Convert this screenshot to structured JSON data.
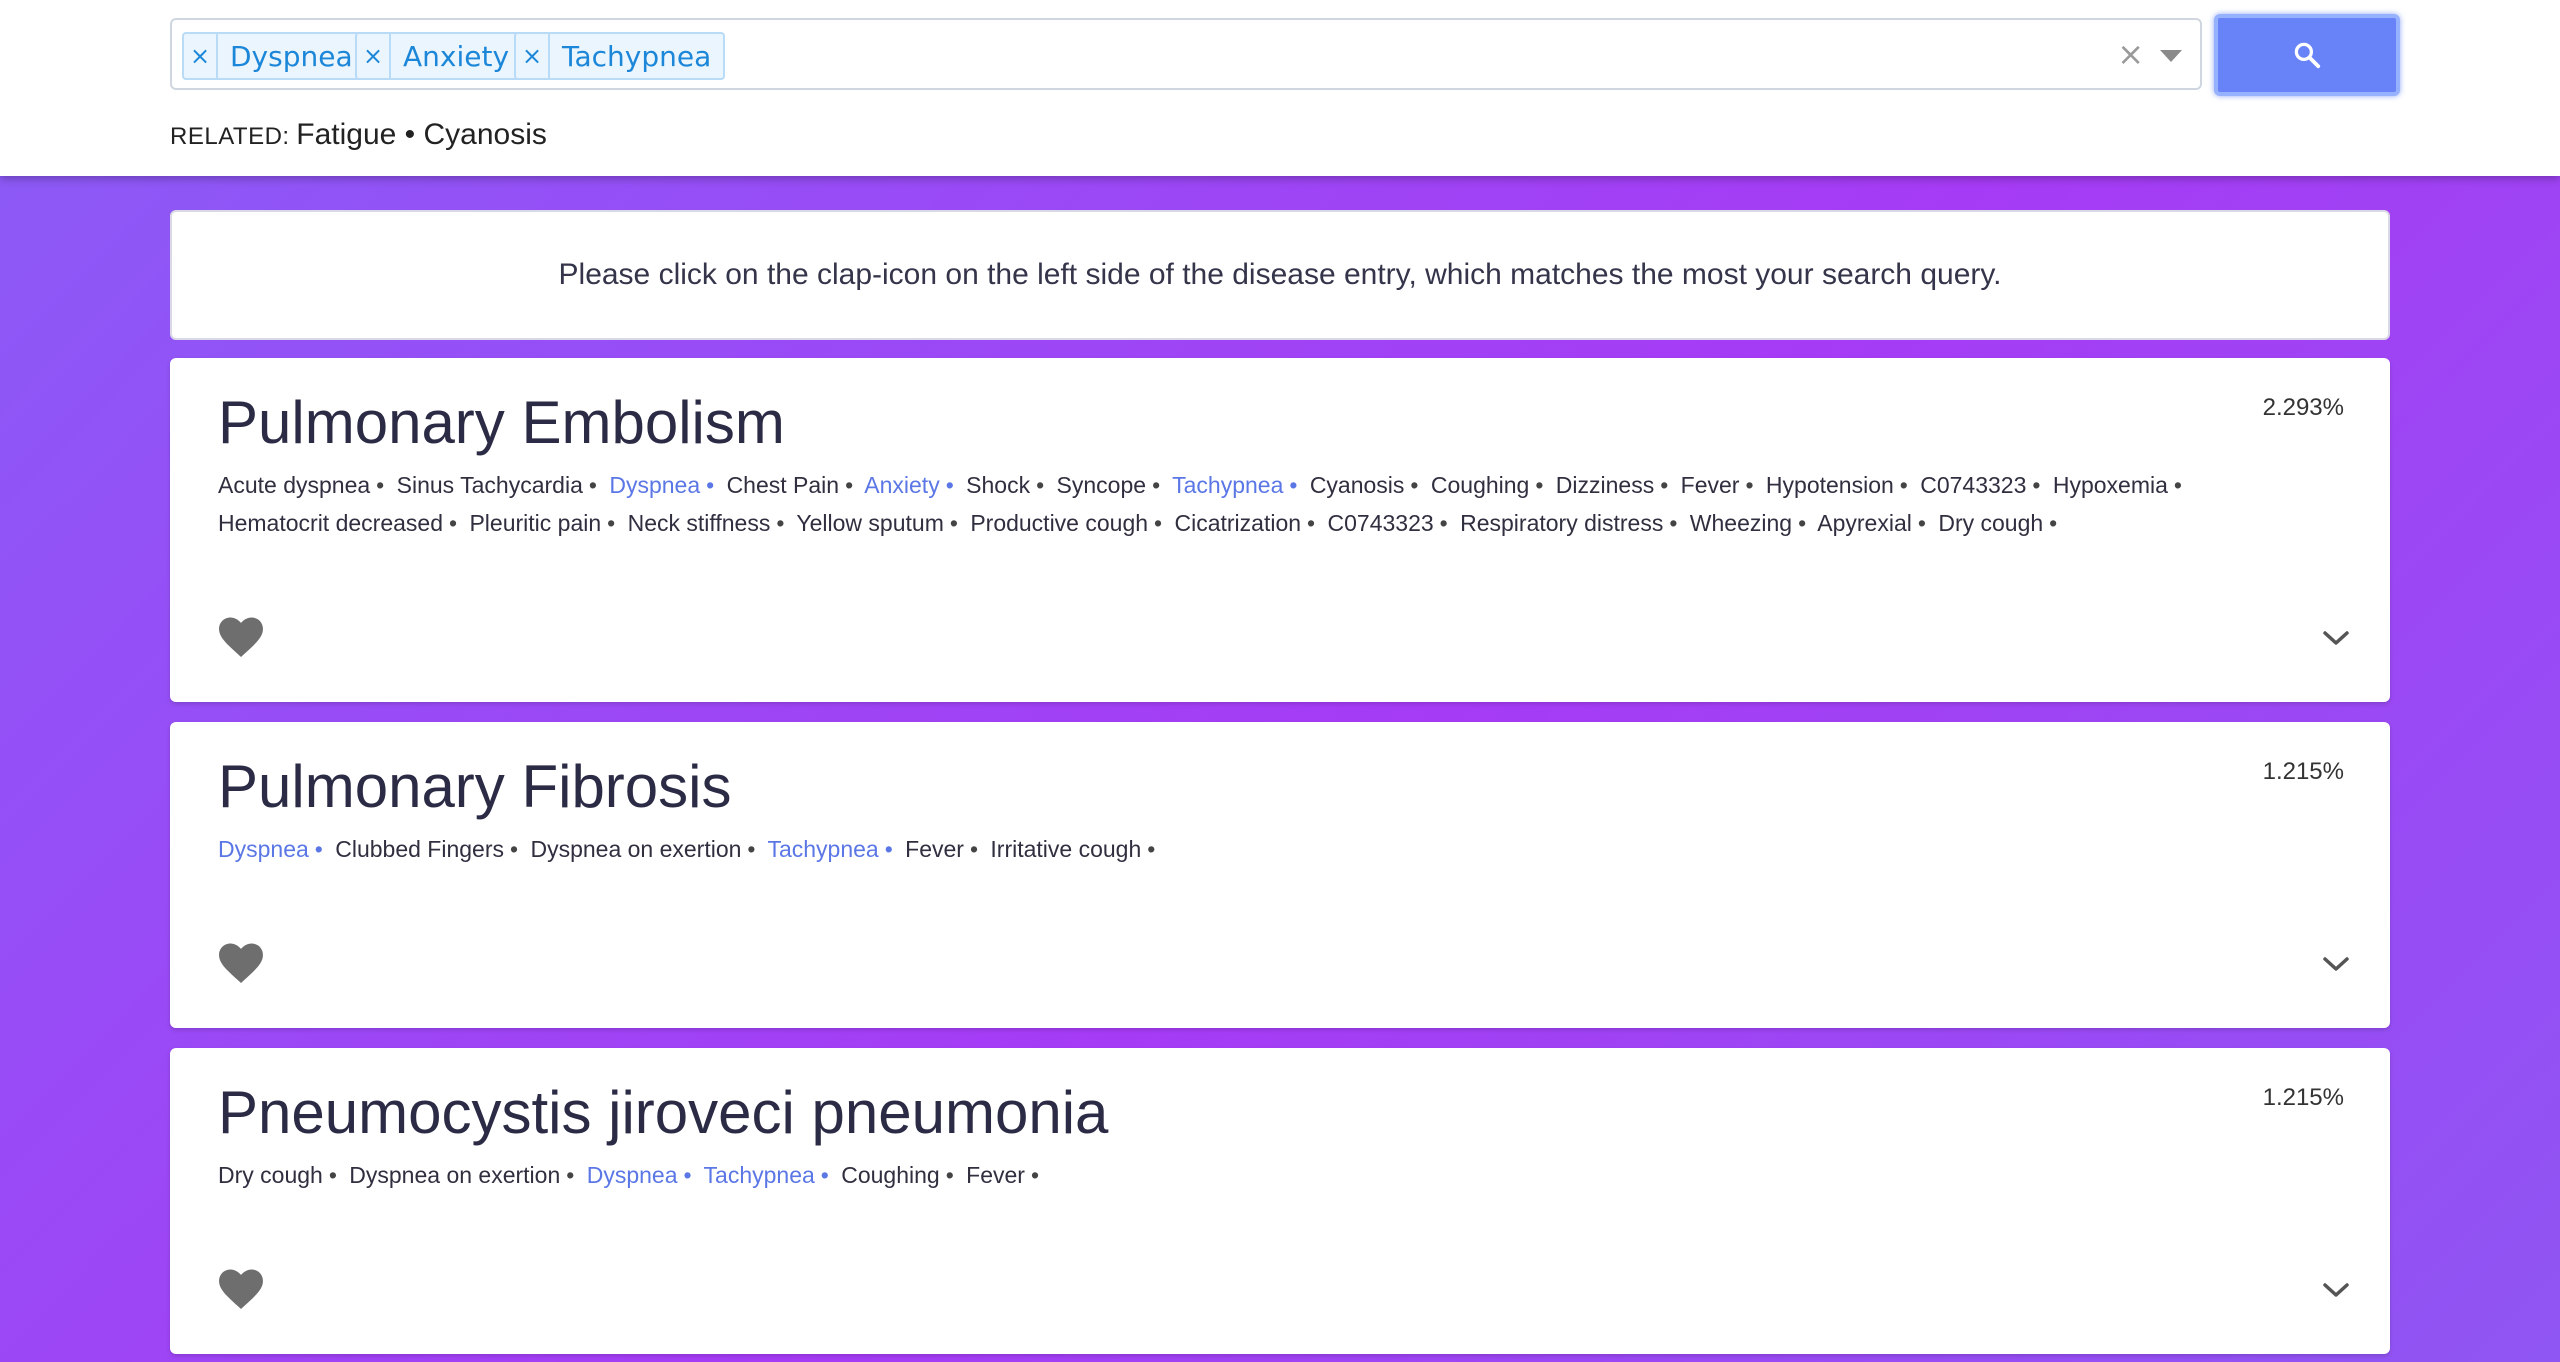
{
  "search": {
    "tags": [
      {
        "label": "Dyspnea"
      },
      {
        "label": "Anxiety"
      },
      {
        "label": "Tachypnea"
      }
    ],
    "clear_icon": "×",
    "tag_remove_icon": "×"
  },
  "related": {
    "label": "RELATED:",
    "items_text": "Fatigue • Cyanosis"
  },
  "info": {
    "message": "Please click on the clap-icon on the left side of the disease entry, which matches the most your search query."
  },
  "results": [
    {
      "title": "Pulmonary Embolism",
      "score": "2.293%",
      "symptoms": [
        {
          "t": "Acute dyspnea",
          "m": false
        },
        {
          "t": "Sinus Tachycardia",
          "m": false
        },
        {
          "t": "Dyspnea",
          "m": true
        },
        {
          "t": "Chest Pain",
          "m": false
        },
        {
          "t": "Anxiety",
          "m": true
        },
        {
          "t": "Shock",
          "m": false
        },
        {
          "t": "Syncope",
          "m": false
        },
        {
          "t": "Tachypnea",
          "m": true
        },
        {
          "t": "Cyanosis",
          "m": false
        },
        {
          "t": "Coughing",
          "m": false
        },
        {
          "t": "Dizziness",
          "m": false
        },
        {
          "t": "Fever",
          "m": false
        },
        {
          "t": "Hypotension",
          "m": false
        },
        {
          "t": "C0743323",
          "m": false
        },
        {
          "t": "Hypoxemia",
          "m": false
        },
        {
          "t": "Hematocrit decreased",
          "m": false
        },
        {
          "t": "Pleuritic pain",
          "m": false
        },
        {
          "t": "Neck stiffness",
          "m": false
        },
        {
          "t": "Yellow sputum",
          "m": false
        },
        {
          "t": "Productive cough",
          "m": false
        },
        {
          "t": "Cicatrization",
          "m": false
        },
        {
          "t": "C0743323",
          "m": false
        },
        {
          "t": "Respiratory distress",
          "m": false
        },
        {
          "t": "Wheezing",
          "m": false
        },
        {
          "t": "Apyrexial",
          "m": false
        },
        {
          "t": "Dry cough",
          "m": false
        }
      ]
    },
    {
      "title": "Pulmonary Fibrosis",
      "score": "1.215%",
      "symptoms": [
        {
          "t": "Dyspnea",
          "m": true
        },
        {
          "t": "Clubbed Fingers",
          "m": false
        },
        {
          "t": "Dyspnea on exertion",
          "m": false
        },
        {
          "t": "Tachypnea",
          "m": true
        },
        {
          "t": "Fever",
          "m": false
        },
        {
          "t": "Irritative cough",
          "m": false
        }
      ]
    },
    {
      "title": "Pneumocystis jiroveci pneumonia",
      "score": "1.215%",
      "symptoms": [
        {
          "t": "Dry cough",
          "m": false
        },
        {
          "t": "Dyspnea on exertion",
          "m": false
        },
        {
          "t": "Dyspnea",
          "m": true
        },
        {
          "t": "Tachypnea",
          "m": true
        },
        {
          "t": "Coughing",
          "m": false
        },
        {
          "t": "Fever",
          "m": false
        }
      ]
    }
  ],
  "separator": "•",
  "icons": {
    "search": "search-icon",
    "heart": "heart-icon",
    "expand": "chevron-down-icon"
  },
  "colors": {
    "accent": "#6883f7",
    "match": "#5b77e6",
    "tag": "#1c87d8"
  }
}
